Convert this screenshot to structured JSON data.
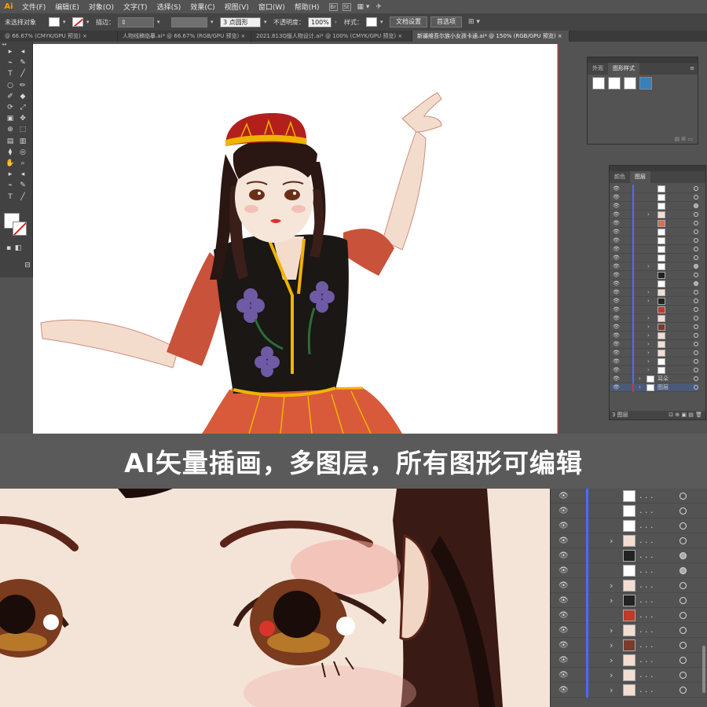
{
  "app": {
    "logo": "Ai"
  },
  "menu": [
    "文件(F)",
    "编辑(E)",
    "对象(O)",
    "文字(T)",
    "选择(S)",
    "效果(C)",
    "视图(V)",
    "窗口(W)",
    "帮助(H)"
  ],
  "menu_right": {
    "br_badge": "Br",
    "st_badge": "St"
  },
  "control_bar": {
    "selection_status": "未选择对象",
    "stroke_label": "描边：",
    "stroke_value": "",
    "brush_value": "3 点圆形",
    "opacity_label": "不透明度：",
    "opacity_value": "100%",
    "style_label": "样式：",
    "doc_setup_button": "文档设置",
    "preferences_button": "首选项"
  },
  "tabs": [
    {
      "label": "@ 66.67% (CMYK/GPU 预览)",
      "active": false
    },
    {
      "label": "人物线稿临摹.ai* @ 66.67% (RGB/GPU 预览)",
      "active": false
    },
    {
      "label": "2021.813Q版人物设计.ai* @ 100% (CMYK/GPU 预览)",
      "active": false
    },
    {
      "label": "新疆维吾尔族小女孩卡通.ai* @ 150% (RGB/GPU 预览)",
      "active": true
    }
  ],
  "appearance_panel": {
    "tabs": [
      "外观",
      "图形样式"
    ],
    "active_tab": "图形样式"
  },
  "layers_panel": {
    "tabs": [
      "颜色",
      "图层"
    ],
    "active_tab": "图层",
    "rows": [
      {
        "chev": false,
        "thumb": "#ffffff",
        "dots": false,
        "filled": false
      },
      {
        "chev": false,
        "thumb": "#ffffff",
        "dots": false,
        "filled": false
      },
      {
        "chev": false,
        "thumb": "#ffffff",
        "dots": false,
        "filled": true
      },
      {
        "chev": true,
        "thumb": "#f3ddd3",
        "dots": false,
        "filled": false
      },
      {
        "chev": false,
        "thumb": "#e06a55",
        "dots": false,
        "filled": false
      },
      {
        "chev": false,
        "thumb": "#ffffff",
        "dots": false,
        "filled": false
      },
      {
        "chev": false,
        "thumb": "#ffffff",
        "dots": false,
        "filled": false
      },
      {
        "chev": false,
        "thumb": "#ffffff",
        "dots": false,
        "filled": false
      },
      {
        "chev": false,
        "thumb": "#ffffff",
        "dots": false,
        "filled": false
      },
      {
        "chev": true,
        "thumb": "#ffffff",
        "dots": false,
        "filled": true
      },
      {
        "chev": false,
        "thumb": "#222222",
        "dots": false,
        "filled": false
      },
      {
        "chev": false,
        "thumb": "#ffffff",
        "dots": false,
        "filled": true
      },
      {
        "chev": true,
        "thumb": "#f3ddd3",
        "dots": false,
        "filled": false
      },
      {
        "chev": true,
        "thumb": "#222222",
        "dots": false,
        "filled": false
      },
      {
        "chev": false,
        "thumb": "#c0392b",
        "dots": false,
        "filled": false
      },
      {
        "chev": true,
        "thumb": "#f3ddd3",
        "dots": false,
        "filled": false
      },
      {
        "chev": true,
        "thumb": "#7a3b2e",
        "dots": false,
        "filled": false
      },
      {
        "chev": true,
        "thumb": "#f3ddd3",
        "dots": false,
        "filled": false
      },
      {
        "chev": true,
        "thumb": "#f3ddd3",
        "dots": false,
        "filled": false
      },
      {
        "chev": true,
        "thumb": "#f3ddd3",
        "dots": false,
        "filled": false
      },
      {
        "chev": true,
        "thumb": "#ffffff",
        "dots": false,
        "filled": false
      },
      {
        "chev": true,
        "thumb": "#ffffff",
        "dots": false,
        "filled": false
      }
    ],
    "named_rows": [
      {
        "label": "耳朵"
      },
      {
        "label": "图层"
      }
    ],
    "footer": "3 图层"
  },
  "banner": {
    "text": "AI矢量插画，多图层，所有图形可编辑"
  },
  "zoom_layers": {
    "rows": [
      {
        "chev": false,
        "thumb": "#ffffff",
        "filled": false
      },
      {
        "chev": false,
        "thumb": "#ffffff",
        "filled": false
      },
      {
        "chev": false,
        "thumb": "#ffffff",
        "filled": false
      },
      {
        "chev": true,
        "thumb": "#f3ddd3",
        "filled": false
      },
      {
        "chev": false,
        "thumb": "#222222",
        "filled": true
      },
      {
        "chev": false,
        "thumb": "#ffffff",
        "filled": true
      },
      {
        "chev": true,
        "thumb": "#f3ddd3",
        "filled": false
      },
      {
        "chev": true,
        "thumb": "#222222",
        "filled": false
      },
      {
        "chev": false,
        "thumb": "#c0392b",
        "filled": false
      },
      {
        "chev": true,
        "thumb": "#f3ddd3",
        "filled": false
      },
      {
        "chev": true,
        "thumb": "#7a3b2e",
        "filled": false
      },
      {
        "chev": true,
        "thumb": "#f3ddd3",
        "filled": false
      },
      {
        "chev": true,
        "thumb": "#f3ddd3",
        "filled": false
      },
      {
        "chev": true,
        "thumb": "#f3ddd3",
        "filled": false
      }
    ]
  },
  "colors": {
    "ui_bg": "#535353",
    "layer_bar": "#4b6bff",
    "vest": "#1a1714",
    "sleeve": "#c9523a",
    "trim": "#f0b400",
    "hat": "#b3201c",
    "skin": "#f4e3d7"
  }
}
